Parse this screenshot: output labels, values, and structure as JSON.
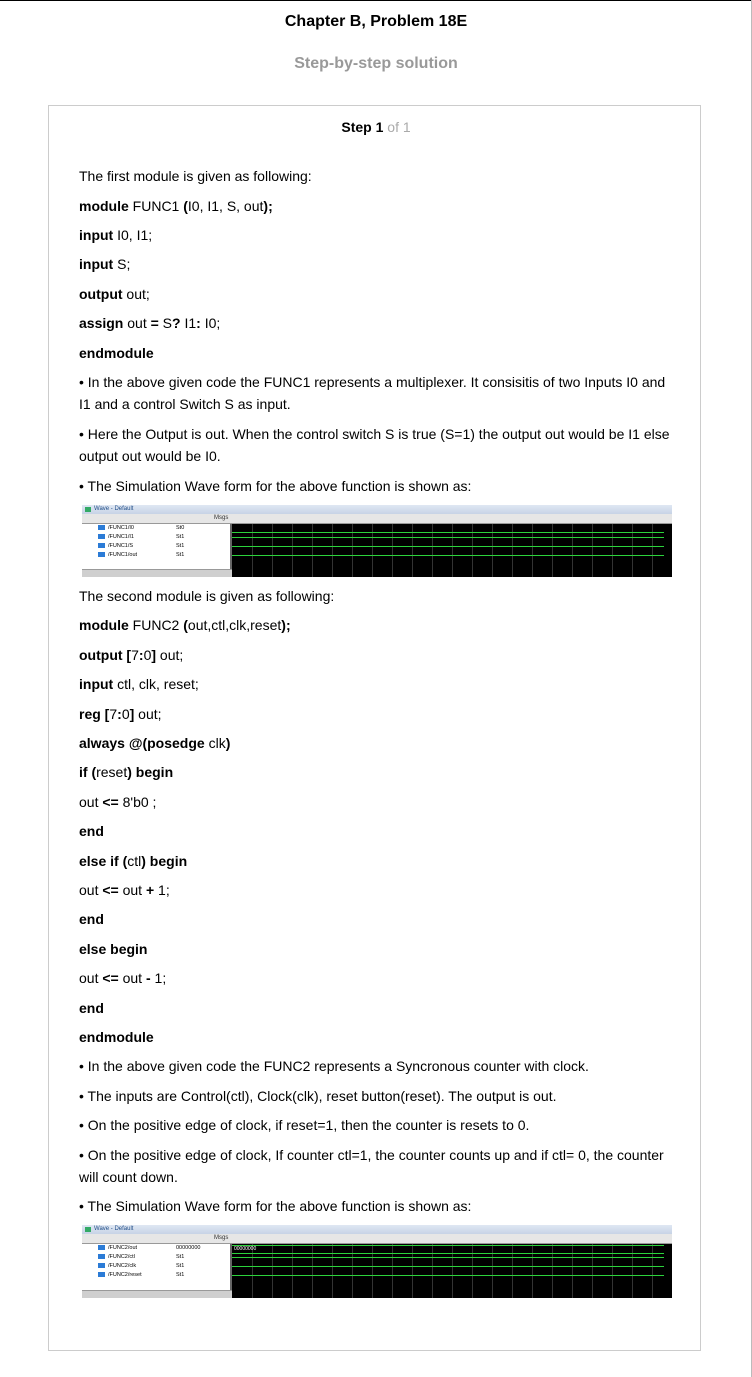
{
  "header": {
    "title": "Chapter B, Problem 18E",
    "subtitle": "Step-by-step solution"
  },
  "step": {
    "label": "Step",
    "number": "1",
    "of_text": "of 1"
  },
  "content": {
    "l1": "The first module is given as following:",
    "l2_kw": "module",
    "l2_a": " FUNC1 ",
    "l2_p": "(",
    "l2_b": "I0, I1, S, out",
    "l2_e": ");",
    "l3_kw": "input",
    "l3_rest": " I0, I1;",
    "l4_kw": "input",
    "l4_rest": " S;",
    "l5_kw": "output",
    "l5_rest": " out;",
    "l6_kw": "assign",
    "l6_a": " out ",
    "l6_eq": "=",
    "l6_b": " S",
    "l6_q": "?",
    "l6_c": " I1",
    "l6_col": ":",
    "l6_d": " I0;",
    "l7_kw": "endmodule",
    "b1": "• In the above given code the FUNC1 represents a multiplexer. It consisitis of two Inputs I0 and I1 and a control Switch S as input.",
    "b2": "• Here the Output is out. When the control switch S is true (S=1) the output out would be I1 else output out would be I0.",
    "b3": "• The Simulation Wave form for the above function is shown as:",
    "m2": "The second module is given as following:",
    "c1_kw": "module",
    "c1_a": " FUNC2 ",
    "c1_p": "(",
    "c1_b": "out,ctl,clk,reset",
    "c1_e": ");",
    "c2_kw": "output [",
    "c2_n1": "7",
    "c2_col": ":",
    "c2_n2": "0",
    "c2_br": "]",
    "c2_rest": " out;",
    "c3_kw": "input",
    "c3_rest": " ctl, clk, reset;",
    "c4_kw": "reg [",
    "c4_n1": "7",
    "c4_col": ":",
    "c4_n2": "0",
    "c4_br": "]",
    "c4_rest": " out;",
    "c5_kw": "always @(posedge",
    "c5_a": " clk",
    "c5_e": ")",
    "c6_kw": "if (",
    "c6_a": "reset",
    "c6_e": ") begin",
    "c7_a": "out ",
    "c7_op": "<=",
    "c7_b": " 8'b0 ;",
    "c8": "end",
    "c9_kw": "else if (",
    "c9_a": "ctl",
    "c9_e": ") begin",
    "c10_a": "out ",
    "c10_op": "<=",
    "c10_b": " out ",
    "c10_op2": "+",
    "c10_c": " 1;",
    "c11": "end",
    "c12": "else begin",
    "c13_a": "out ",
    "c13_op": "<=",
    "c13_b": " out ",
    "c13_op2": "-",
    "c13_c": " 1;",
    "c14": "end",
    "c15": "endmodule",
    "d1": "• In the above given code the FUNC2 represents a Syncronous counter with clock.",
    "d2": "• The inputs are Control(ctl), Clock(clk), reset button(reset). The output is out.",
    "d3": "• On the positive edge of clock, if reset=1, then the counter is resets to 0.",
    "d4": "• On the positive edge of clock, If counter ctl=1, the counter counts up and if ctl= 0, the counter will count down.",
    "d5": "• The Simulation Wave form for the above function is shown as:"
  },
  "wave1": {
    "title": "Wave - Default",
    "msgs": "Msgs",
    "signals": [
      {
        "name": "/FUNC1/I0",
        "value": "St0"
      },
      {
        "name": "/FUNC1/I1",
        "value": "St1"
      },
      {
        "name": "/FUNC1/S",
        "value": "St1"
      },
      {
        "name": "/FUNC1/out",
        "value": "St1"
      }
    ]
  },
  "wave2": {
    "title": "Wave - Default",
    "msgs": "Msgs",
    "bus_value": "00000000",
    "signals": [
      {
        "name": "/FUNC2/out",
        "value": "00000000"
      },
      {
        "name": "/FUNC2/ctl",
        "value": "St1"
      },
      {
        "name": "/FUNC2/clk",
        "value": "St1"
      },
      {
        "name": "/FUNC2/reset",
        "value": "St1"
      }
    ]
  },
  "colors": {
    "signal": "#2bd33b",
    "muted": "#999999"
  }
}
